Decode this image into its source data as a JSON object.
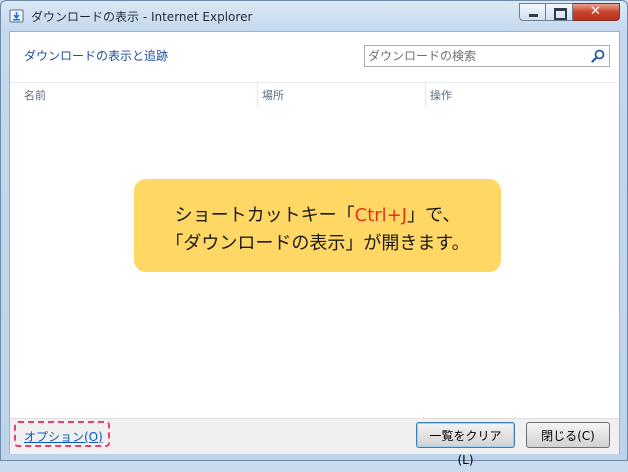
{
  "window": {
    "title": "ダウンロードの表示 - Internet Explorer",
    "icon": "ie-download-icon"
  },
  "header": {
    "heading": "ダウンロードの表示と追跡",
    "search_placeholder": "ダウンロードの検索"
  },
  "columns": [
    "名前",
    "場所",
    "操作"
  ],
  "footer": {
    "options_label": "オプション(O)",
    "clear_label": "一覧をクリア(L)",
    "close_label": "閉じる(C)"
  },
  "callout": {
    "line1_prefix": "ショートカットキー「",
    "line1_key": "Ctrl+J",
    "line1_suffix": "」で、",
    "line2": "「ダウンロードの表示」が開きます。"
  },
  "colors": {
    "callout_bg": "#fed765",
    "shortcut_key": "#e8321b",
    "highlight_border": "#e8406e",
    "link": "#0b57c6"
  }
}
